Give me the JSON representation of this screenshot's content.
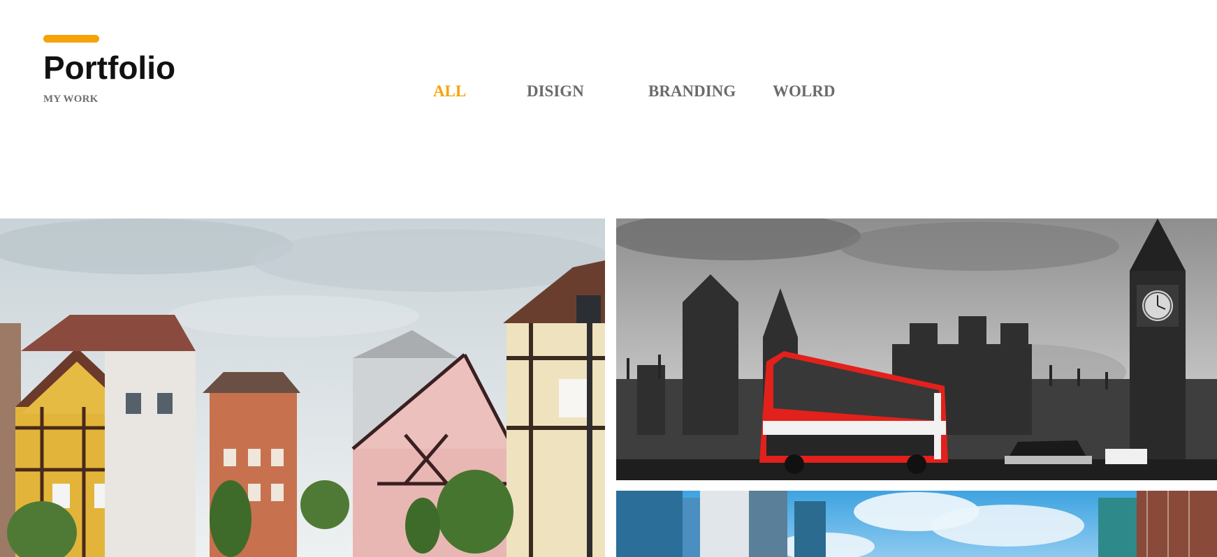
{
  "header": {
    "title": "Portfolio",
    "subtitle": "MY WORK",
    "accent_color": "#f5a30a"
  },
  "filters": {
    "items": [
      {
        "label": "ALL",
        "active": true
      },
      {
        "label": "DISIGN",
        "active": false
      },
      {
        "label": "BRANDING",
        "active": false
      },
      {
        "label": "WOLRD",
        "active": false
      }
    ],
    "active_color": "#f5a30a",
    "inactive_color": "#6b6b6b"
  },
  "gallery": {
    "items": [
      {
        "name": "village-photo",
        "description_icon": "half-timbered-houses-image"
      },
      {
        "name": "london-photo",
        "description_icon": "red-bus-big-ben-image"
      },
      {
        "name": "city-photo",
        "description_icon": "skyscrapers-image"
      }
    ]
  }
}
